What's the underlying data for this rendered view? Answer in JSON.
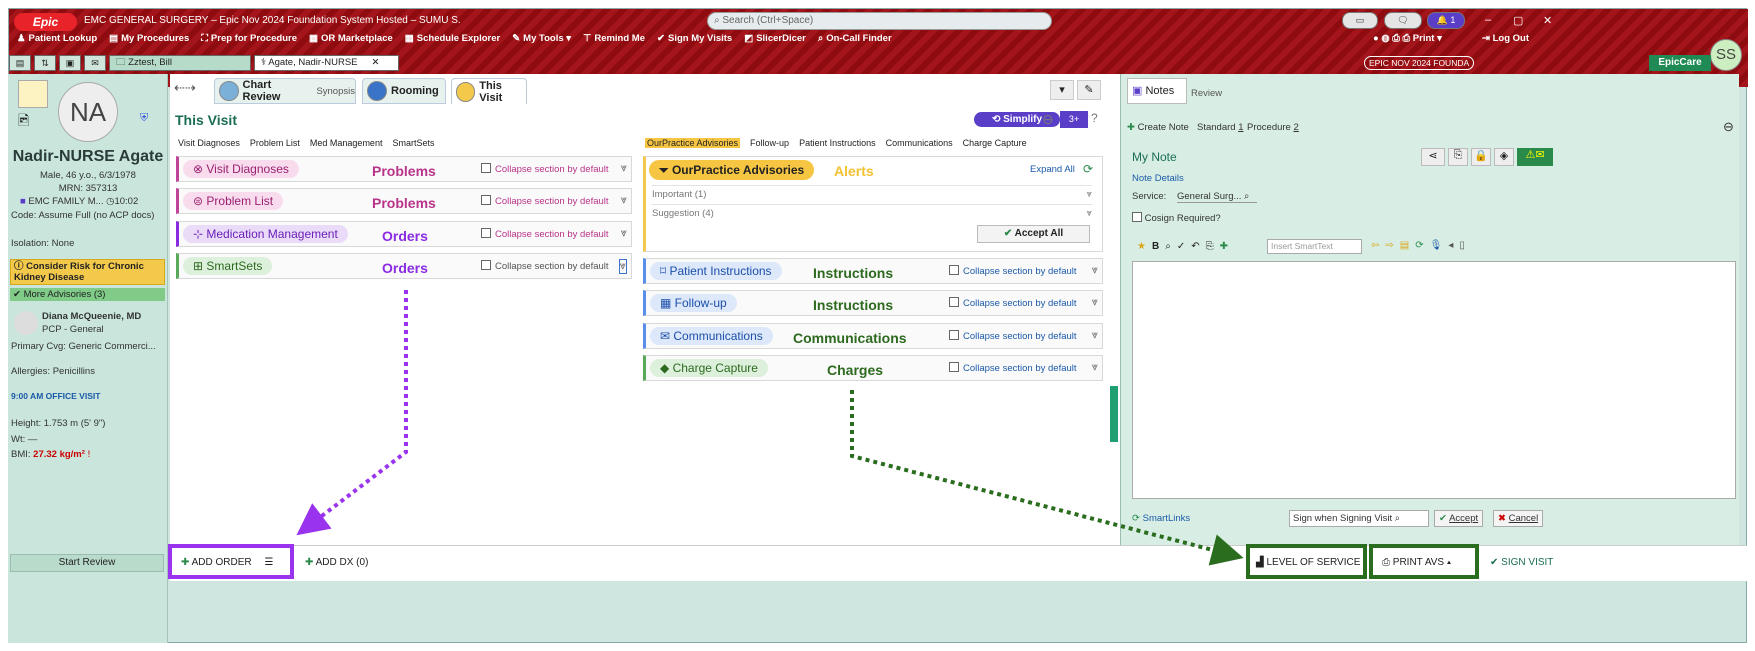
{
  "app": {
    "logo": "Epic",
    "title": "EMC GENERAL SURGERY – Epic Nov 2024 Foundation System Hosted – SUMU S.",
    "search_placeholder": "Search (Ctrl+Space)",
    "notif_count": "1",
    "env_label": "EPIC NOV 2024 FOUNDA",
    "product": "EpicCare",
    "user_initials": "SS",
    "print": "Print",
    "logout": "Log Out"
  },
  "toolbar": [
    "Patient Lookup",
    "My Procedures",
    "Prep for Procedure",
    "OR Marketplace",
    "Schedule Explorer",
    "My Tools",
    "Remind Me",
    "Sign My Visits",
    "SlicerDicer",
    "On-Call Finder"
  ],
  "tabs": {
    "tab1": "Zztest, Bill",
    "tab2": "Agate, Nadir-NURSE"
  },
  "patient": {
    "initials": "NA",
    "name": "Nadir-NURSE Agate",
    "demo": "Male, 46 y.o., 6/3/1978",
    "mrn": "MRN: 357313",
    "dept": "EMC FAMILY M...",
    "time": "10:02",
    "code": "Code: Assume Full (no ACP docs)",
    "isolation": "Isolation: None",
    "alert": "Consider Risk for Chronic Kidney Disease",
    "advisories": "More Advisories (3)",
    "pcp_name": "Diana McQueenie, MD",
    "pcp_role": "PCP - General",
    "coverage": "Primary Cvg: Generic Commerci...",
    "allergies": "Allergies: Penicillins",
    "visit": "9:00 AM OFFICE VISIT",
    "height": "Height:  1.753 m (5' 9\")",
    "wt": "Wt: —",
    "bmi_label": "BMI:",
    "bmi": "27.32 kg/m²",
    "start_review": "Start Review"
  },
  "activities": {
    "chart_review": "Chart Review",
    "synopsis": "Synopsis",
    "rooming": "Rooming",
    "this_visit": "This Visit"
  },
  "visit": {
    "title": "This Visit",
    "simplify": "Simplify",
    "count": "3+"
  },
  "left_jumps": [
    "Visit Diagnoses",
    "Problem List",
    "Med Management",
    "SmartSets"
  ],
  "right_jumps": [
    "OurPractice Advisories",
    "Follow-up",
    "Patient Instructions",
    "Communications",
    "Charge Capture"
  ],
  "collapse": "Collapse section by default",
  "left_sections": [
    {
      "name": "Visit Diagnoses",
      "tag": "Problems"
    },
    {
      "name": "Problem List",
      "tag": "Problems"
    },
    {
      "name": "Medication Management",
      "tag": "Orders"
    },
    {
      "name": "SmartSets",
      "tag": "Orders"
    }
  ],
  "advisory": {
    "title": "OurPractice Advisories",
    "tag": "Alerts",
    "expand": "Expand All",
    "important": "Important (1)",
    "suggestion": "Suggestion (4)",
    "accept": "Accept All"
  },
  "right_sections": [
    {
      "name": "Patient Instructions",
      "tag": "Instructions"
    },
    {
      "name": "Follow-up",
      "tag": "Instructions"
    },
    {
      "name": "Communications",
      "tag": "Communications"
    },
    {
      "name": "Charge Capture",
      "tag": "Charges"
    }
  ],
  "notes": {
    "tab_notes": "Notes",
    "tab_review": "Review",
    "create": "Create Note",
    "standard": "Standard",
    "standard_n": "1",
    "procedure": "Procedure",
    "procedure_n": "2",
    "my_note": "My Note",
    "details": "Note Details",
    "service_label": "Service:",
    "service": "General Surg...",
    "cosign": "Cosign Required?",
    "smarttext": "Insert SmartText",
    "smartlinks": "SmartLinks",
    "sign_when": "Sign when Signing Visit",
    "accept": "Accept",
    "cancel": "Cancel"
  },
  "bottom": {
    "add_order": "ADD ORDER",
    "add_dx": "ADD DX (0)",
    "level_service": "LEVEL OF SERVICE",
    "print_avs": "PRINT AVS",
    "sign_visit": "SIGN VISIT"
  },
  "colors": {
    "purple_outline": "#9933ee",
    "green_outline": "#2a6d1f",
    "problems": "#b8348a",
    "orders": "#8a2be2",
    "instructions": "#2d6a1f",
    "alerts": "#f1c232"
  }
}
